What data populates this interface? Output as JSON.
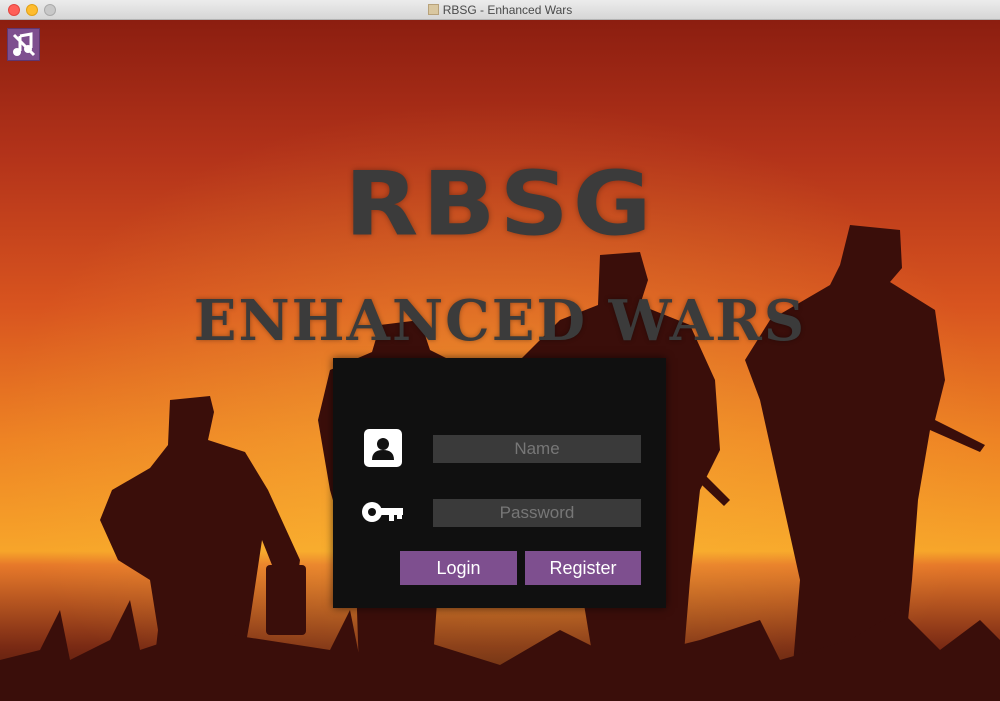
{
  "window": {
    "title": "RBSG - Enhanced Wars"
  },
  "logo": {
    "main": "RBSG",
    "sub": "ENHANCED WARS"
  },
  "audio": {
    "icon": "music-muted-icon"
  },
  "login": {
    "name_placeholder": "Name",
    "name_value": "",
    "password_placeholder": "Password",
    "password_value": "",
    "login_label": "Login",
    "register_label": "Register"
  },
  "colors": {
    "accent": "#7e4f8f",
    "panel": "#101010",
    "input": "#3a3a3a",
    "logo": "#3b3b3b"
  }
}
